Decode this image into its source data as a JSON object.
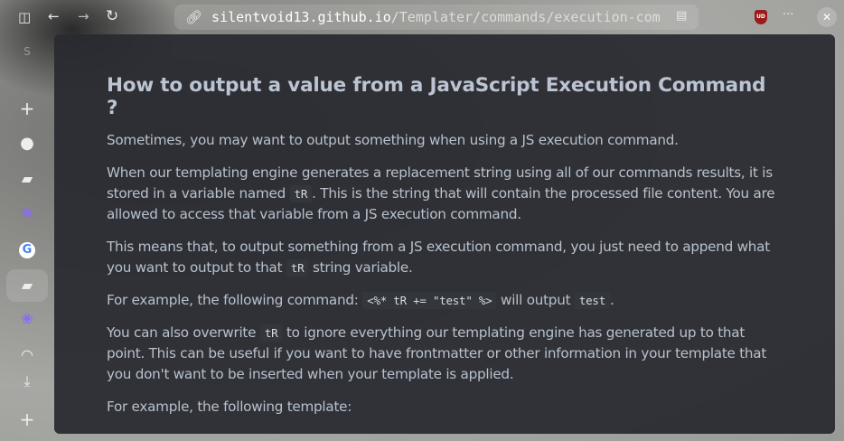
{
  "browser": {
    "url_host": "silentvoid13.github.io",
    "url_path": "/Templater/commands/execution-com",
    "extension_badge": "UD",
    "more_label": "···",
    "close_label": "✕"
  },
  "sidebar": {
    "space_letter": "S",
    "items": [
      {
        "icon": "plus-icon",
        "glyph": "+"
      },
      {
        "icon": "github-icon",
        "glyph": "●"
      },
      {
        "icon": "markdown-book-icon",
        "glyph": "▰"
      },
      {
        "icon": "paw-icon",
        "glyph": "❀"
      },
      {
        "icon": "google-icon",
        "glyph": "G"
      },
      {
        "icon": "markdown-book-icon",
        "glyph": "▰"
      },
      {
        "icon": "paw-icon",
        "glyph": "❀"
      },
      {
        "icon": "loading-arc-icon",
        "glyph": "◠"
      },
      {
        "icon": "download-icon",
        "glyph": "⤓"
      },
      {
        "icon": "plus-icon",
        "glyph": "+"
      }
    ]
  },
  "content": {
    "title": "How to output a value from a JavaScript Execution Command ?",
    "p1": "Sometimes, you may want to output something when using a JS execution command.",
    "p2a": "When our templating engine generates a replacement string using all of our commands results, it is stored in a variable named ",
    "p2code": "tR",
    "p2b": ". This is the string that will contain the processed file content. You are allowed to access that variable from a JS execution command.",
    "p3a": "This means that, to output something from a JS execution command, you just need to append what you want to output to that ",
    "p3code": "tR",
    "p3b": " string variable.",
    "p4a": "For example, the following command: ",
    "p4code": "<%* tR += \"test\" %>",
    "p4b": " will output ",
    "p4code2": "test",
    "p4c": ".",
    "p5a": "You can also overwrite ",
    "p5code": "tR",
    "p5b": " to ignore everything our templating engine has generated up to that point. This can be useful if you want to have frontmatter or other information in your template that you don't want to be inserted when your template is applied.",
    "p6": "For example, the following template:"
  }
}
